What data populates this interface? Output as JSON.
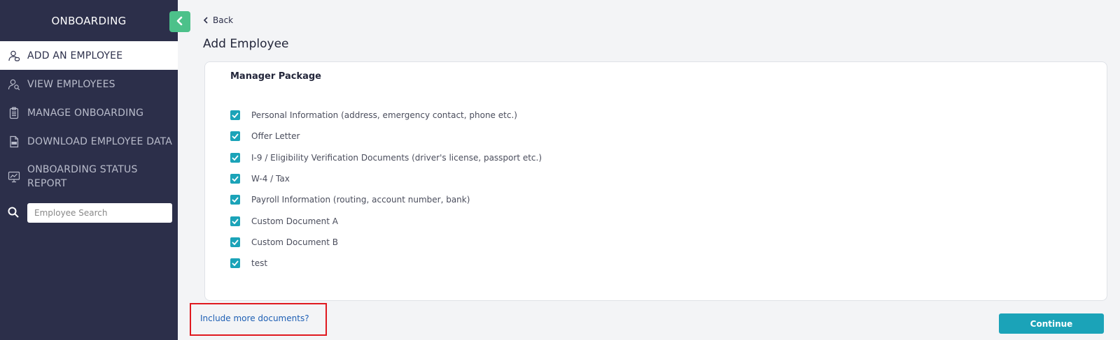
{
  "sidebar": {
    "title": "ONBOARDING",
    "items": [
      {
        "label": "ADD AN EMPLOYEE",
        "icon": "add-user-icon",
        "active": true
      },
      {
        "label": "VIEW EMPLOYEES",
        "icon": "view-user-icon",
        "active": false
      },
      {
        "label": "MANAGE ONBOARDING",
        "icon": "clipboard-icon",
        "active": false
      },
      {
        "label": "DOWNLOAD EMPLOYEE DATA",
        "icon": "csv-file-icon",
        "active": false
      },
      {
        "label_line1": "ONBOARDING STATUS",
        "label_line2": "REPORT",
        "icon": "chart-board-icon",
        "active": false
      }
    ],
    "search": {
      "placeholder": "Employee Search",
      "value": ""
    }
  },
  "colors": {
    "sidebar_bg": "#2c2f4a",
    "accent_green": "#4cc18a",
    "teal": "#1ba3b8",
    "link_blue": "#1e5fb4",
    "highlight_red": "#e0191f"
  },
  "main": {
    "back_label": "Back",
    "page_title": "Add Employee",
    "package": {
      "title": "Manager Package",
      "documents": [
        {
          "label": "Personal Information (address, emergency contact, phone etc.)",
          "checked": true
        },
        {
          "label": "Offer Letter",
          "checked": true
        },
        {
          "label": "I-9 / Eligibility Verification Documents (driver's license, passport etc.)",
          "checked": true
        },
        {
          "label": "W-4 / Tax",
          "checked": true
        },
        {
          "label": "Payroll Information (routing, account number, bank)",
          "checked": true
        },
        {
          "label": "Custom Document A",
          "checked": true
        },
        {
          "label": "Custom Document B",
          "checked": true
        },
        {
          "label": "test",
          "checked": true
        }
      ]
    },
    "include_more_label": "Include more documents?",
    "continue_label": "Continue"
  }
}
